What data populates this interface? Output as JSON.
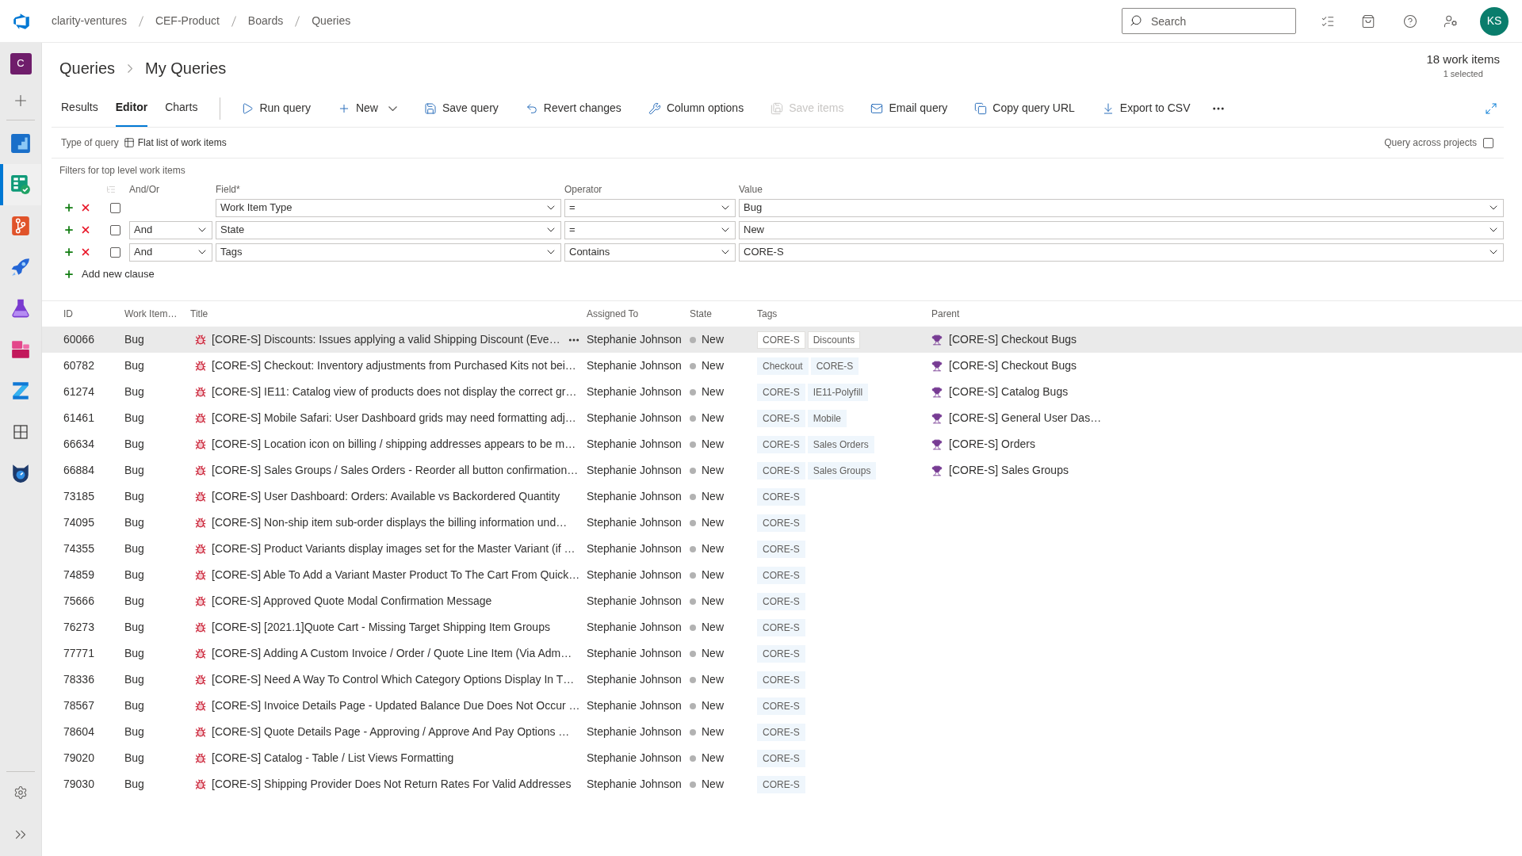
{
  "top_bar": {
    "breadcrumb": [
      "clarity-ventures",
      "CEF-Product",
      "Boards",
      "Queries"
    ],
    "search": {
      "placeholder": "Search"
    },
    "avatar": "KS"
  },
  "sidebar": {
    "project": "C",
    "items": [
      {
        "kind": "overview",
        "selected": false
      },
      {
        "kind": "boards",
        "selected": true
      },
      {
        "kind": "repos",
        "selected": false
      },
      {
        "kind": "pipelines",
        "selected": false
      },
      {
        "kind": "tests",
        "selected": false
      },
      {
        "kind": "artifacts",
        "selected": false
      },
      {
        "kind": "zigzag",
        "selected": false
      },
      {
        "kind": "grid",
        "selected": false
      },
      {
        "kind": "cat",
        "selected": false
      }
    ]
  },
  "header": {
    "breadcrumb": [
      "Queries",
      "My Queries"
    ],
    "count": "18 work items",
    "selection": "1 selected"
  },
  "tabs": [
    {
      "label": "Results",
      "selected": false
    },
    {
      "label": "Editor",
      "selected": true
    },
    {
      "label": "Charts",
      "selected": false
    }
  ],
  "toolbar": {
    "commands": [
      {
        "kind": "run",
        "label": "Run query",
        "disabled": false
      },
      {
        "kind": "new",
        "label": "New",
        "disabled": false,
        "dropdown": true
      },
      {
        "kind": "save",
        "label": "Save query",
        "disabled": false
      },
      {
        "kind": "revert",
        "label": "Revert changes",
        "disabled": false
      },
      {
        "kind": "columns",
        "label": "Column options",
        "disabled": false
      },
      {
        "kind": "saveitems",
        "label": "Save items",
        "disabled": true
      },
      {
        "kind": "email",
        "label": "Email query",
        "disabled": false
      },
      {
        "kind": "copy",
        "label": "Copy query URL",
        "disabled": false
      },
      {
        "kind": "export",
        "label": "Export to CSV",
        "disabled": false
      }
    ]
  },
  "query_type": {
    "label": "Type of query",
    "value": "Flat list of work items"
  },
  "query_across_projects": {
    "label": "Query across projects",
    "checked": false
  },
  "filters": {
    "title": "Filters for top level work items",
    "columns": [
      "And/Or",
      "Field*",
      "Operator",
      "Value"
    ],
    "clauses": [
      {
        "checked": false,
        "field": "Work Item Type",
        "operator": "=",
        "value": "Bug"
      },
      {
        "checked": false,
        "and_or": "And",
        "field": "State",
        "operator": "=",
        "value": "New"
      },
      {
        "checked": false,
        "and_or": "And",
        "field": "Tags",
        "operator": "Contains",
        "value": "CORE-S"
      }
    ],
    "add_clause": "Add new clause"
  },
  "results": {
    "columns": [
      "ID",
      "Work Item…",
      "Title",
      "Assigned To",
      "State",
      "Tags",
      "Parent"
    ],
    "rows": [
      {
        "id": "60066",
        "type": "Bug",
        "title": "[CORE-S] Discounts: Issues applying a valid Shipping Discount (Eve…",
        "assigned_to": "Stephanie Johnson",
        "state": "New",
        "tags": [
          "CORE-S",
          "Discounts"
        ],
        "parent": "[CORE-S] Checkout Bugs",
        "selected": true
      },
      {
        "id": "60782",
        "type": "Bug",
        "title": "[CORE-S] Checkout: Inventory adjustments from Purchased Kits not bei…",
        "assigned_to": "Stephanie Johnson",
        "state": "New",
        "tags": [
          "Checkout",
          "CORE-S"
        ],
        "parent": "[CORE-S] Checkout Bugs",
        "selected": false
      },
      {
        "id": "61274",
        "type": "Bug",
        "title": "[CORE-S] IE11: Catalog view of products does not display the correct gr…",
        "assigned_to": "Stephanie Johnson",
        "state": "New",
        "tags": [
          "CORE-S",
          "IE11-Polyfill"
        ],
        "parent": "[CORE-S] Catalog Bugs",
        "selected": false
      },
      {
        "id": "61461",
        "type": "Bug",
        "title": "[CORE-S] Mobile Safari: User Dashboard grids may need formatting adj…",
        "assigned_to": "Stephanie Johnson",
        "state": "New",
        "tags": [
          "CORE-S",
          "Mobile"
        ],
        "parent": "[CORE-S] General User Das…",
        "selected": false
      },
      {
        "id": "66634",
        "type": "Bug",
        "title": "[CORE-S] Location icon on billing / shipping addresses appears to be m…",
        "assigned_to": "Stephanie Johnson",
        "state": "New",
        "tags": [
          "CORE-S",
          "Sales Orders"
        ],
        "parent": "[CORE-S] Orders",
        "selected": false
      },
      {
        "id": "66884",
        "type": "Bug",
        "title": "[CORE-S] Sales Groups / Sales Orders - Reorder all button confirmation…",
        "assigned_to": "Stephanie Johnson",
        "state": "New",
        "tags": [
          "CORE-S",
          "Sales Groups"
        ],
        "parent": "[CORE-S] Sales Groups",
        "selected": false
      },
      {
        "id": "73185",
        "type": "Bug",
        "title": "[CORE-S] User Dashboard: Orders: Available vs Backordered Quantity",
        "assigned_to": "Stephanie Johnson",
        "state": "New",
        "tags": [
          "CORE-S"
        ],
        "selected": false
      },
      {
        "id": "74095",
        "type": "Bug",
        "title": "[CORE-S] Non-ship item sub-order displays the billing information und…",
        "assigned_to": "Stephanie Johnson",
        "state": "New",
        "tags": [
          "CORE-S"
        ],
        "selected": false
      },
      {
        "id": "74355",
        "type": "Bug",
        "title": "[CORE-S] Product Variants display images set for the Master Variant (if …",
        "assigned_to": "Stephanie Johnson",
        "state": "New",
        "tags": [
          "CORE-S"
        ],
        "selected": false
      },
      {
        "id": "74859",
        "type": "Bug",
        "title": "[CORE-S] Able To Add a Variant Master Product To The Cart From Quick…",
        "assigned_to": "Stephanie Johnson",
        "state": "New",
        "tags": [
          "CORE-S"
        ],
        "selected": false
      },
      {
        "id": "75666",
        "type": "Bug",
        "title": "[CORE-S] Approved Quote Modal Confirmation Message",
        "assigned_to": "Stephanie Johnson",
        "state": "New",
        "tags": [
          "CORE-S"
        ],
        "selected": false
      },
      {
        "id": "76273",
        "type": "Bug",
        "title": "[CORE-S] [2021.1]Quote Cart - Missing Target Shipping Item Groups",
        "assigned_to": "Stephanie Johnson",
        "state": "New",
        "tags": [
          "CORE-S"
        ],
        "selected": false
      },
      {
        "id": "77771",
        "type": "Bug",
        "title": "[CORE-S] Adding A Custom Invoice / Order / Quote Line Item (Via Adm…",
        "assigned_to": "Stephanie Johnson",
        "state": "New",
        "tags": [
          "CORE-S"
        ],
        "selected": false
      },
      {
        "id": "78336",
        "type": "Bug",
        "title": "[CORE-S] Need A Way To Control Which Category Options Display In T…",
        "assigned_to": "Stephanie Johnson",
        "state": "New",
        "tags": [
          "CORE-S"
        ],
        "selected": false
      },
      {
        "id": "78567",
        "type": "Bug",
        "title": "[CORE-S] Invoice Details Page - Updated Balance Due Does Not Occur …",
        "assigned_to": "Stephanie Johnson",
        "state": "New",
        "tags": [
          "CORE-S"
        ],
        "selected": false
      },
      {
        "id": "78604",
        "type": "Bug",
        "title": "[CORE-S] Quote Details Page - Approving / Approve And Pay Options …",
        "assigned_to": "Stephanie Johnson",
        "state": "New",
        "tags": [
          "CORE-S"
        ],
        "selected": false
      },
      {
        "id": "79020",
        "type": "Bug",
        "title": "[CORE-S] Catalog - Table / List Views Formatting",
        "assigned_to": "Stephanie Johnson",
        "state": "New",
        "tags": [
          "CORE-S"
        ],
        "selected": false
      },
      {
        "id": "79030",
        "type": "Bug",
        "title": "[CORE-S] Shipping Provider Does Not Return Rates For Valid Addresses",
        "assigned_to": "Stephanie Johnson",
        "state": "New",
        "tags": [
          "CORE-S"
        ],
        "selected": false
      }
    ]
  }
}
